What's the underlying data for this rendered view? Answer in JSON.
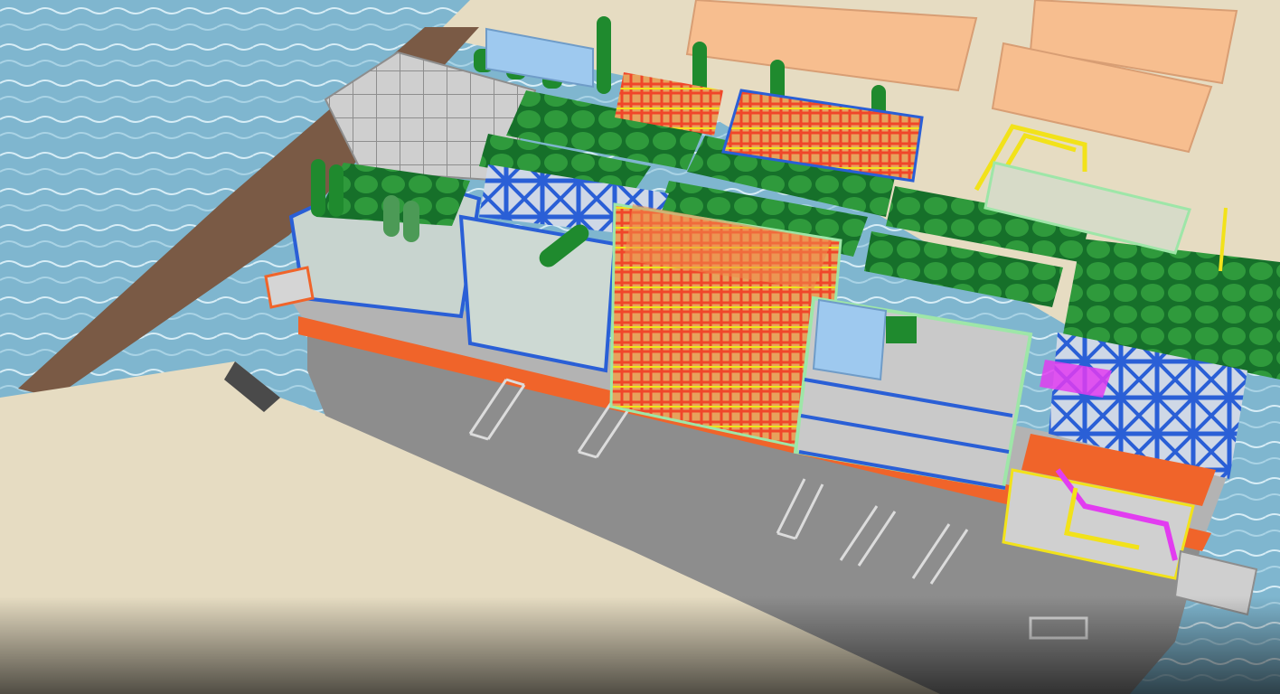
{
  "scene": {
    "subject": "floating-production-vessel-3d-model",
    "colors": {
      "water": "#7fb6cf",
      "quay": "#e6dcc2",
      "hull": "#9a9a9a",
      "deck": "#bdbdbd",
      "equipment_green": "#1f8a2e",
      "structure_blue": "#2a5fd6",
      "frame_green": "#9ee6a8",
      "pipe_yellow": "#f2e21a",
      "pipe_orange": "#f0642a",
      "pipe_magenta": "#e23cf0",
      "block_peach": "#f7be8f",
      "sky_blue_block": "#9ec9ef"
    }
  },
  "caption": {
    "text": ""
  }
}
